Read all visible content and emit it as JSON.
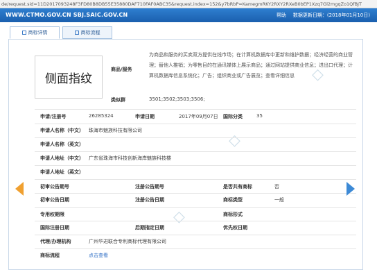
{
  "browser": {
    "url": "de/request.sid=11D2017093248F3FD80B8DB55E35880DAF710FAF0ABC35&request.index=152&y7bRbP=KamegmRKY2RXY2RXeB0bEP1Xzq7Gl2mgqZo1QfBJT"
  },
  "header": {
    "site_title": "WWW.CTMO.GOV.CN SBJ.SAIC.GOV.CN",
    "help": "帮助",
    "data_update": "数据更新日期：(2018年01月10日)"
  },
  "tabs": [
    {
      "label": "商标详情"
    },
    {
      "label": "商标流程"
    }
  ],
  "watermark": {
    "text": "侧面指纹"
  },
  "goods": {
    "label": "商品/服务",
    "text": "为商品和服务的买卖双方提供在线市场；在计算机数据库中更新和维护数据；经济经营的商业管理；替他人推销；为零售目的在通讯媒体上展示商品；通过网站提供商业信息；进出口代理；计算机数据库信息系统化；广告；组织商业或广告展览；查看详细信息"
  },
  "similar_group": {
    "label": "类似群",
    "value": "3501;3502;3503;3506;"
  },
  "fields": {
    "reg_no_label": "申请/注册号",
    "reg_no": "26285324",
    "app_date_label": "申请日期",
    "app_date": "2017年09月07日",
    "intl_class_label": "国际分类",
    "intl_class": "35",
    "applicant_cn_label": "申请人名称（中文）",
    "applicant_cn": "珠海市魅族科技有限公司",
    "applicant_en_label": "申请人名称（英文）",
    "applicant_en": "",
    "address_cn_label": "申请人地址（中文）",
    "address_cn": "广东省珠海市科技创新海岸魅族科技楼",
    "address_en_label": "申请人地址（英文）",
    "address_en": "",
    "prelim_no_label": "初审公告期号",
    "prelim_no": "",
    "reg_ann_no_label": "注册公告期号",
    "reg_ann_no": "",
    "shared_label": "是否共有商标",
    "shared": "否",
    "prelim_date_label": "初审公告日期",
    "prelim_date": "",
    "reg_ann_date_label": "注册公告日期",
    "reg_ann_date": "",
    "tm_type_label": "商标类型",
    "tm_type": "一般",
    "exclusive_label": "专用权期限",
    "exclusive": "",
    "tm_form_label": "商标形式",
    "tm_form": "",
    "intl_reg_date_label": "国际注册日期",
    "intl_reg_date": "",
    "later_date_label": "后期指定日期",
    "later_date": "",
    "priority_date_label": "优先权日期",
    "priority_date": "",
    "agent_label": "代理/办理机构",
    "agent": "广州华进联合专利商标代理有限公司",
    "process_label": "商标流程",
    "process_link": "点击查看"
  }
}
